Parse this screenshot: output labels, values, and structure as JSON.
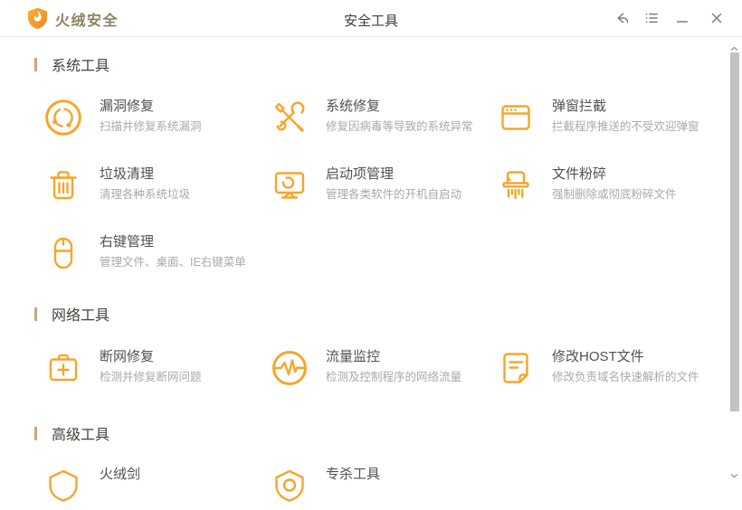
{
  "window": {
    "app_name": "火绒安全",
    "page_title": "安全工具",
    "controls": {
      "back": "back-arrow-icon",
      "menu": "task-list-icon",
      "minimize": "minimize-icon",
      "close": "close-icon"
    }
  },
  "colors": {
    "accent_orange": "#F7A52B",
    "brand_text": "#8C8260",
    "section_bar": "#C7A87E",
    "tool_title": "#515151",
    "tool_desc": "#a9a9a9",
    "scrollbar_thumb": "#c2c2c2"
  },
  "sections": [
    {
      "title": "系统工具",
      "tools": [
        {
          "name": "漏洞修复",
          "desc": "扫描并修复系统漏洞",
          "icon": "vulnerability-fix-icon"
        },
        {
          "name": "系统修复",
          "desc": "修复因病毒等导致的系统异常",
          "icon": "system-repair-icon"
        },
        {
          "name": "弹窗拦截",
          "desc": "拦截程序推送的不受欢迎弹窗",
          "icon": "popup-block-icon"
        },
        {
          "name": "垃圾清理",
          "desc": "清理各种系统垃圾",
          "icon": "junk-clean-icon"
        },
        {
          "name": "启动项管理",
          "desc": "管理各类软件的开机自启动",
          "icon": "startup-manager-icon"
        },
        {
          "name": "文件粉碎",
          "desc": "强制删除或彻底粉碎文件",
          "icon": "file-shredder-icon"
        },
        {
          "name": "右键管理",
          "desc": "管理文件、桌面、IE右键菜单",
          "icon": "right-click-menu-icon"
        }
      ]
    },
    {
      "title": "网络工具",
      "tools": [
        {
          "name": "断网修复",
          "desc": "检测并修复断网问题",
          "icon": "network-repair-icon"
        },
        {
          "name": "流量监控",
          "desc": "检测及控制程序的网络流量",
          "icon": "traffic-monitor-icon"
        },
        {
          "name": "修改HOST文件",
          "desc": "修改负责域名快速解析的文件",
          "icon": "host-file-icon"
        }
      ]
    },
    {
      "title": "高级工具",
      "tools": [
        {
          "name": "火绒剑",
          "desc": "",
          "icon": "huorong-sword-icon"
        },
        {
          "name": "专杀工具",
          "desc": "",
          "icon": "special-kill-tool-icon"
        }
      ]
    }
  ]
}
